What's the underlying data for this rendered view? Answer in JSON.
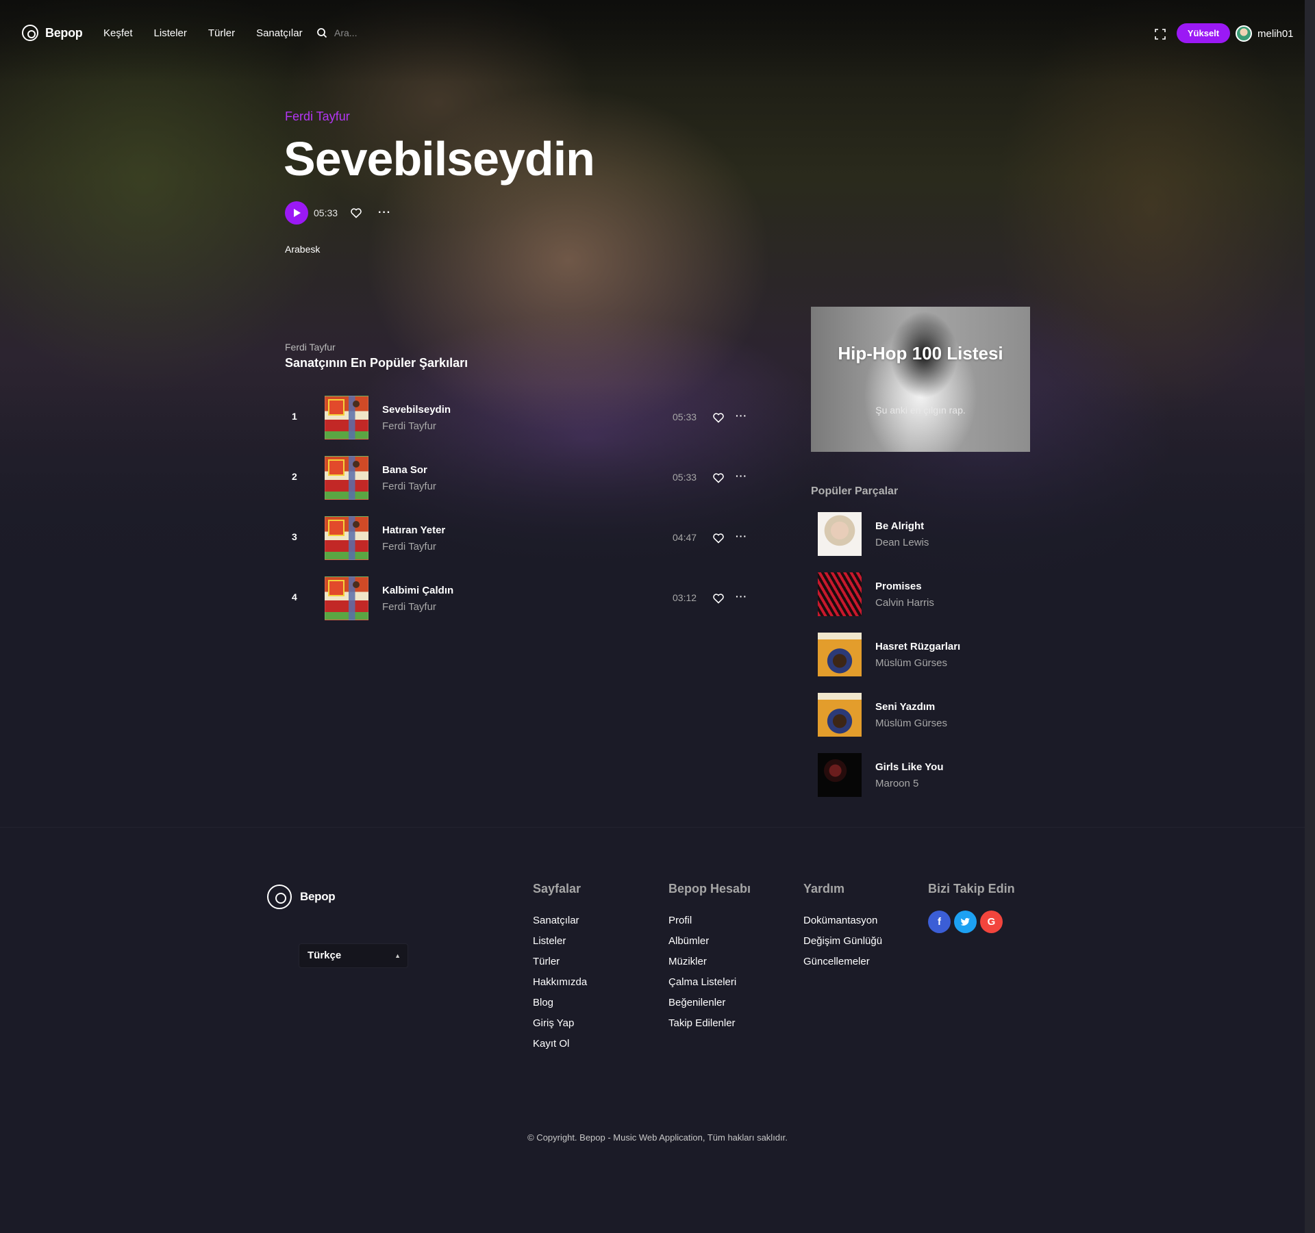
{
  "header": {
    "brand": "Bepop",
    "nav": [
      "Keşfet",
      "Listeler",
      "Türler",
      "Sanatçılar"
    ],
    "search_placeholder": "Ara...",
    "upgrade_label": "Yükselt",
    "username": "melih01"
  },
  "hero": {
    "artist": "Ferdi Tayfur",
    "title": "Sevebilseydin",
    "duration": "05:33",
    "more": "···",
    "genre": "Arabesk"
  },
  "artist_top": {
    "subtitle": "Ferdi Tayfur",
    "title": "Sanatçının En Popüler Şarkıları",
    "tracks": [
      {
        "num": "1",
        "title": "Sevebilseydin",
        "artist": "Ferdi Tayfur",
        "duration": "05:33"
      },
      {
        "num": "2",
        "title": "Bana Sor",
        "artist": "Ferdi Tayfur",
        "duration": "05:33"
      },
      {
        "num": "3",
        "title": "Hatıran Yeter",
        "artist": "Ferdi Tayfur",
        "duration": "04:47"
      },
      {
        "num": "4",
        "title": "Kalbimi Çaldın",
        "artist": "Ferdi Tayfur",
        "duration": "03:12"
      }
    ]
  },
  "promo": {
    "title": "Hip-Hop 100 Listesi",
    "subtitle": "Şu anki en çılgın rap."
  },
  "popular": {
    "heading": "Popüler Parçalar",
    "tracks": [
      {
        "title": "Be Alright",
        "artist": "Dean Lewis"
      },
      {
        "title": "Promises",
        "artist": "Calvin Harris"
      },
      {
        "title": "Hasret Rüzgarları",
        "artist": "Müslüm Gürses"
      },
      {
        "title": "Seni Yazdım",
        "artist": "Müslüm Gürses"
      },
      {
        "title": "Girls Like You",
        "artist": "Maroon 5"
      }
    ]
  },
  "footer": {
    "brand": "Bepop",
    "language": "Türkçe",
    "columns": [
      {
        "heading": "Sayfalar",
        "links": [
          "Sanatçılar",
          "Listeler",
          "Türler",
          "Hakkımızda",
          "Blog",
          "Giriş Yap",
          "Kayıt Ol"
        ]
      },
      {
        "heading": "Bepop Hesabı",
        "links": [
          "Profil",
          "Albümler",
          "Müzikler",
          "Çalma Listeleri",
          "Beğenilenler",
          "Takip Edilenler"
        ]
      },
      {
        "heading": "Yardım",
        "links": [
          "Dokümantasyon",
          "Değişim Günlüğü",
          "Güncellemeler"
        ]
      }
    ],
    "social_heading": "Bizi Takip Edin",
    "social": {
      "facebook": "f",
      "google": "G"
    },
    "copyright": "© Copyright. Bepop - Music Web Application, Tüm hakları saklıdır."
  },
  "colors": {
    "accent": "#9b19f5",
    "artist_link": "#b336f5",
    "background": "#1b1b27"
  }
}
